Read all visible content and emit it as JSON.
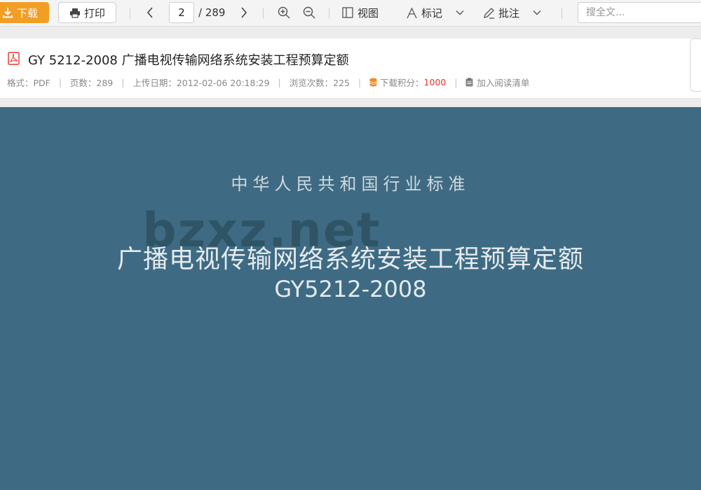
{
  "toolbar": {
    "download_label": "下载",
    "print_label": "打印",
    "current_page": "2",
    "total_pages": "/ 289",
    "view_label": "视图",
    "mark_label": "标记",
    "annotate_label": "批注",
    "search_placeholder": "搜全文..."
  },
  "doc": {
    "title": "GY 5212-2008 广播电视传输网络系统安装工程预算定额",
    "format": "格式：PDF",
    "pages": "页数：289",
    "upload_date": "上传日期：2012-02-06 20:18:29",
    "views": "浏览次数：225",
    "points_label": "下载积分：",
    "points_value": "1000",
    "reading_list": "加入阅读清单"
  },
  "page_content": {
    "watermark": "bzxz.net",
    "category": "中华人民共和国行业标准",
    "title": "广播电视传输网络系统安装工程预算定额",
    "code": "GY5212-2008"
  },
  "colors": {
    "accent": "#f29d24",
    "points": "#e0362f",
    "page_bg": "#3e6b83"
  },
  "icons": [
    "download-icon",
    "printer-icon",
    "chevron-left-icon",
    "chevron-right-icon",
    "zoom-in-icon",
    "zoom-out-icon",
    "view-icon",
    "mark-icon",
    "pen-icon",
    "chevron-down-icon",
    "pdf-icon",
    "coins-icon",
    "clipboard-icon"
  ]
}
